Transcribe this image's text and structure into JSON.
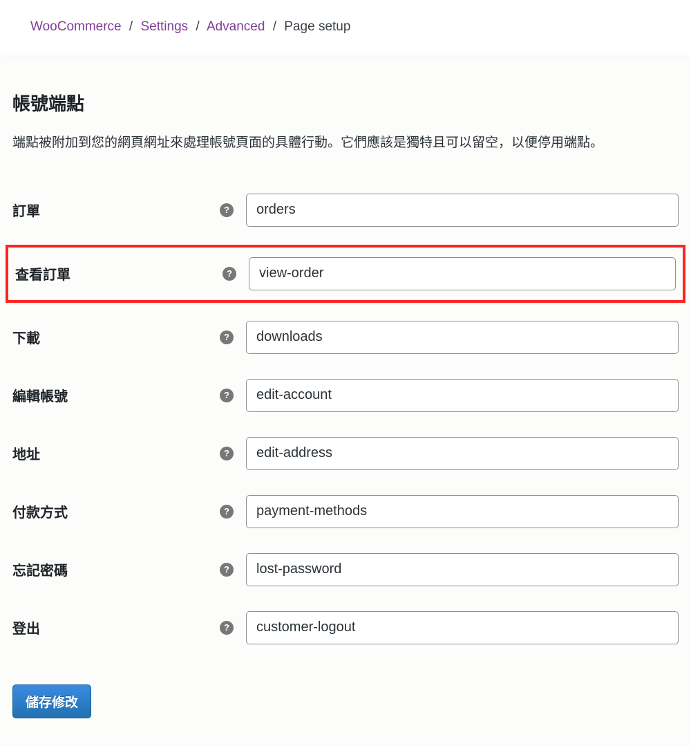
{
  "breadcrumb": {
    "items": [
      {
        "label": "WooCommerce",
        "link": true
      },
      {
        "label": "Settings",
        "link": true
      },
      {
        "label": "Advanced",
        "link": true
      },
      {
        "label": "Page setup",
        "link": false
      }
    ],
    "separator": "/"
  },
  "section": {
    "title": "帳號端點",
    "description": "端點被附加到您的網頁網址來處理帳號頁面的具體行動。它們應該是獨特且可以留空，以便停用端點。"
  },
  "fields": [
    {
      "label": "訂單",
      "value": "orders",
      "highlighted": false,
      "name": "orders"
    },
    {
      "label": "查看訂單",
      "value": "view-order",
      "highlighted": true,
      "name": "view-order"
    },
    {
      "label": "下載",
      "value": "downloads",
      "highlighted": false,
      "name": "downloads"
    },
    {
      "label": "編輯帳號",
      "value": "edit-account",
      "highlighted": false,
      "name": "edit-account"
    },
    {
      "label": "地址",
      "value": "edit-address",
      "highlighted": false,
      "name": "edit-address"
    },
    {
      "label": "付款方式",
      "value": "payment-methods",
      "highlighted": false,
      "name": "payment-methods"
    },
    {
      "label": "忘記密碼",
      "value": "lost-password",
      "highlighted": false,
      "name": "lost-password"
    },
    {
      "label": "登出",
      "value": "customer-logout",
      "highlighted": false,
      "name": "customer-logout"
    }
  ],
  "help_glyph": "?",
  "save_button": "儲存修改"
}
